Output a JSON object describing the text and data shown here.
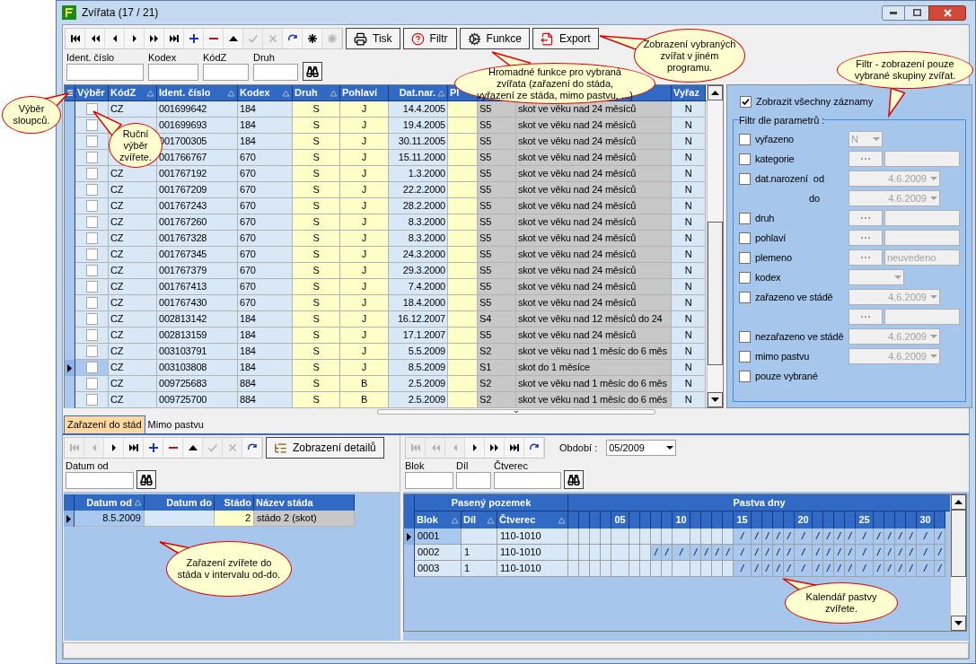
{
  "window": {
    "title": "Zvířata (17 / 21)"
  },
  "toolbar": {
    "navigator": [
      {
        "kind": "first",
        "disabled": false
      },
      {
        "kind": "rewind",
        "disabled": false
      },
      {
        "kind": "prev",
        "disabled": false
      },
      {
        "kind": "next",
        "disabled": false
      },
      {
        "kind": "ffwd",
        "disabled": false
      },
      {
        "kind": "last",
        "disabled": false
      },
      {
        "kind": "plus",
        "disabled": false
      },
      {
        "kind": "minus",
        "disabled": false
      },
      {
        "kind": "up",
        "disabled": false
      },
      {
        "kind": "check",
        "disabled": true
      },
      {
        "kind": "x",
        "disabled": true
      },
      {
        "kind": "refresh",
        "disabled": false
      },
      {
        "kind": "star",
        "disabled": false
      },
      {
        "kind": "star",
        "disabled": true
      }
    ],
    "buttons": [
      {
        "kind": "print",
        "label": "Tisk"
      },
      {
        "kind": "filter",
        "label": "Filtr"
      },
      {
        "kind": "functions",
        "label": "Funkce"
      },
      {
        "kind": "export",
        "label": "Export"
      }
    ]
  },
  "search": [
    {
      "label": "Ident. číslo"
    },
    {
      "label": "Kodex"
    },
    {
      "label": "KódZ"
    },
    {
      "label": "Druh"
    }
  ],
  "grid": {
    "columns": [
      {
        "label": "Výběr",
        "sortable": false
      },
      {
        "label": "KódZ",
        "sortable": true
      },
      {
        "label": "Ident. číslo",
        "sortable": true
      },
      {
        "label": "Kodex",
        "sortable": true
      },
      {
        "label": "Druh",
        "sortable": true
      },
      {
        "label": "Pohlaví",
        "sortable": false
      },
      {
        "label": "Dat.nar.",
        "sortable": true
      },
      {
        "label": "Pl",
        "sortable": false
      },
      {
        "label": "Vyřaz",
        "sortable": false
      }
    ],
    "rows": [
      {
        "selected": false,
        "checked": false,
        "kodz": "CZ",
        "ident": "001699642",
        "kodex": "184",
        "druh": "S",
        "pohlavi": "J",
        "datnar": "14.4.2005",
        "kat": "S5",
        "popis": "skot ve věku nad 24 měsíců",
        "vyraz": "N"
      },
      {
        "selected": false,
        "checked": false,
        "ident": "001699693",
        "kodex": "184",
        "druh": "S",
        "pohlavi": "J",
        "datnar": "19.4.2005",
        "kat": "S5",
        "popis": "skot ve věku nad 24 měsíců",
        "vyraz": "N"
      },
      {
        "selected": false,
        "checked": false,
        "ident": "001700305",
        "kodex": "184",
        "druh": "S",
        "pohlavi": "J",
        "datnar": "30.11.2005",
        "kat": "S5",
        "popis": "skot ve věku nad 24 měsíců",
        "vyraz": "N"
      },
      {
        "selected": false,
        "checked": false,
        "ident": "001766767",
        "kodex": "670",
        "druh": "S",
        "pohlavi": "J",
        "datnar": "15.11.2000",
        "kat": "S5",
        "popis": "skot ve věku nad 24 měsíců",
        "vyraz": "N"
      },
      {
        "selected": false,
        "checked": false,
        "kodz": "CZ",
        "ident": "001767192",
        "kodex": "670",
        "druh": "S",
        "pohlavi": "J",
        "datnar": "1.3.2000",
        "kat": "S5",
        "popis": "skot ve věku nad 24 měsíců",
        "vyraz": "N"
      },
      {
        "selected": false,
        "checked": false,
        "kodz": "CZ",
        "ident": "001767209",
        "kodex": "670",
        "druh": "S",
        "pohlavi": "J",
        "datnar": "22.2.2000",
        "kat": "S5",
        "popis": "skot ve věku nad 24 měsíců",
        "vyraz": "N"
      },
      {
        "selected": false,
        "checked": false,
        "kodz": "CZ",
        "ident": "001767243",
        "kodex": "670",
        "druh": "S",
        "pohlavi": "J",
        "datnar": "28.2.2000",
        "kat": "S5",
        "popis": "skot ve věku nad 24 měsíců",
        "vyraz": "N"
      },
      {
        "selected": false,
        "checked": false,
        "kodz": "CZ",
        "ident": "001767260",
        "kodex": "670",
        "druh": "S",
        "pohlavi": "J",
        "datnar": "8.3.2000",
        "kat": "S5",
        "popis": "skot ve věku nad 24 měsíců",
        "vyraz": "N"
      },
      {
        "selected": false,
        "checked": false,
        "kodz": "CZ",
        "ident": "001767328",
        "kodex": "670",
        "druh": "S",
        "pohlavi": "J",
        "datnar": "8.3.2000",
        "kat": "S5",
        "popis": "skot ve věku nad 24 měsíců",
        "vyraz": "N"
      },
      {
        "selected": false,
        "checked": false,
        "kodz": "CZ",
        "ident": "001767345",
        "kodex": "670",
        "druh": "S",
        "pohlavi": "J",
        "datnar": "24.3.2000",
        "kat": "S5",
        "popis": "skot ve věku nad 24 měsíců",
        "vyraz": "N"
      },
      {
        "selected": false,
        "checked": false,
        "kodz": "CZ",
        "ident": "001767379",
        "kodex": "670",
        "druh": "S",
        "pohlavi": "J",
        "datnar": "29.3.2000",
        "kat": "S5",
        "popis": "skot ve věku nad 24 měsíců",
        "vyraz": "N"
      },
      {
        "selected": false,
        "checked": false,
        "kodz": "CZ",
        "ident": "001767413",
        "kodex": "670",
        "druh": "S",
        "pohlavi": "J",
        "datnar": "7.4.2000",
        "kat": "S5",
        "popis": "skot ve věku nad 24 měsíců",
        "vyraz": "N"
      },
      {
        "selected": false,
        "checked": false,
        "kodz": "CZ",
        "ident": "001767430",
        "kodex": "670",
        "druh": "S",
        "pohlavi": "J",
        "datnar": "18.4.2000",
        "kat": "S5",
        "popis": "skot ve věku nad 24 měsíců",
        "vyraz": "N"
      },
      {
        "selected": false,
        "checked": false,
        "kodz": "CZ",
        "ident": "002813142",
        "kodex": "184",
        "druh": "S",
        "pohlavi": "J",
        "datnar": "16.12.2007",
        "kat": "S4",
        "popis": "skot ve věku nad 12 měsíců do 24",
        "vyraz": "N"
      },
      {
        "selected": false,
        "checked": false,
        "kodz": "CZ",
        "ident": "002813159",
        "kodex": "184",
        "druh": "S",
        "pohlavi": "J",
        "datnar": "17.1.2007",
        "kat": "S5",
        "popis": "skot ve věku nad 24 měsíců",
        "vyraz": "N"
      },
      {
        "selected": false,
        "checked": false,
        "kodz": "CZ",
        "ident": "003103791",
        "kodex": "184",
        "druh": "S",
        "pohlavi": "J",
        "datnar": "5.5.2009",
        "kat": "S2",
        "popis": "skot ve věku nad 1 měsíc do 6 měs",
        "vyraz": "N"
      },
      {
        "selected": true,
        "checked": false,
        "kodz": "CZ",
        "ident": "003103808",
        "kodex": "184",
        "druh": "S",
        "pohlavi": "J",
        "datnar": "8.5.2009",
        "kat": "S1",
        "popis": "skot do 1 měsíce",
        "vyraz": "N"
      },
      {
        "selected": false,
        "checked": false,
        "kodz": "CZ",
        "ident": "009725683",
        "kodex": "884",
        "druh": "S",
        "pohlavi": "B",
        "datnar": "2.5.2009",
        "kat": "S2",
        "popis": "skot ve věku nad 1 měsíc do 6 měs",
        "vyraz": "N"
      },
      {
        "selected": false,
        "checked": false,
        "kodz": "CZ",
        "ident": "009725700",
        "kodex": "884",
        "druh": "S",
        "pohlavi": "B",
        "datnar": "2.5.2009",
        "kat": "S2",
        "popis": "skot ve věku nad 1 měsíc do 6 měs",
        "vyraz": "N"
      }
    ]
  },
  "filter_panel": {
    "show_all": {
      "label": "Zobrazit všechny záznamy",
      "checked": true
    },
    "legend": "Filtr dle parametrů :",
    "filters": [
      {
        "kind": "combo",
        "label": "vyřazeno",
        "checked": false,
        "value": "N"
      },
      {
        "kind": "lookup",
        "label": "kategorie",
        "checked": false
      },
      {
        "kind": "date",
        "label": "dat.narození",
        "sub_label": "od",
        "checked": false,
        "value": "4.6.2009"
      },
      {
        "kind": "date_more",
        "sub_label": "do",
        "value": "4.6.2009"
      },
      {
        "kind": "lookup",
        "label": "druh",
        "checked": false
      },
      {
        "kind": "lookup",
        "label": "pohlaví",
        "checked": false
      },
      {
        "kind": "lookup",
        "label": "plemeno",
        "checked": false,
        "value": "neuvedeno"
      },
      {
        "kind": "combo_wide",
        "label": "kodex",
        "checked": false
      },
      {
        "kind": "date",
        "label": "zařazeno ve stádě",
        "checked": false,
        "value": "4.6.2009"
      },
      {
        "kind": "lookup_more"
      },
      {
        "kind": "date",
        "label": "nezařazeno ve stádě",
        "checked": false,
        "value": "4.6.2009"
      },
      {
        "kind": "date",
        "label": "mimo pastvu",
        "checked": false,
        "value": "4.6.2009"
      },
      {
        "kind": "check",
        "label": "pouze vybrané",
        "checked": false
      }
    ]
  },
  "tabs": [
    {
      "label": "Zařazení do stád",
      "selected": true
    },
    {
      "label": "Mimo pastvu",
      "selected": false
    }
  ],
  "herd_panel": {
    "navigator": [
      {
        "kind": "first",
        "disabled": true
      },
      {
        "kind": "prev",
        "disabled": true
      },
      {
        "kind": "next",
        "disabled": false
      },
      {
        "kind": "last",
        "disabled": false
      },
      {
        "kind": "plus",
        "disabled": false
      },
      {
        "kind": "minus",
        "disabled": false
      },
      {
        "kind": "up",
        "disabled": false
      },
      {
        "kind": "check",
        "disabled": true
      },
      {
        "kind": "x",
        "disabled": true
      },
      {
        "kind": "refresh",
        "disabled": false
      }
    ],
    "details_button": "Zobrazení detailů",
    "search": [
      {
        "label": "Datum od"
      }
    ],
    "columns": [
      {
        "label": "Datum od",
        "sortable": true
      },
      {
        "label": "Datum do",
        "sortable": false
      },
      {
        "label": "Stádo",
        "sortable": false
      },
      {
        "label": "Název stáda",
        "sortable": false
      }
    ],
    "rows": [
      {
        "selected": true,
        "datum_od": "8.5.2009",
        "stado": "2",
        "nazev": "stádo 2 (skot)"
      }
    ]
  },
  "pasture_panel": {
    "navigator": [
      {
        "kind": "first",
        "disabled": true
      },
      {
        "kind": "rewind",
        "disabled": true
      },
      {
        "kind": "prev",
        "disabled": true
      },
      {
        "kind": "next",
        "disabled": false
      },
      {
        "kind": "ffwd",
        "disabled": false
      },
      {
        "kind": "last",
        "disabled": false
      },
      {
        "kind": "refresh",
        "disabled": false
      }
    ],
    "period": {
      "label": "Období :",
      "value": "05/2009"
    },
    "search": [
      {
        "label": "Blok"
      },
      {
        "label": "Díl"
      },
      {
        "label": "Čtverec"
      }
    ],
    "group_headers": [
      "Pasený pozemek",
      "Pastva dny"
    ],
    "columns": [
      {
        "label": "Blok",
        "sortable": true
      },
      {
        "label": "Díl",
        "sortable": true
      },
      {
        "label": "Čtverec",
        "sortable": true
      }
    ],
    "days": [
      {
        "wide": false
      },
      {
        "wide": false
      },
      {
        "wide": false
      },
      {
        "wide": false
      },
      {
        "wide": true,
        "label": "05"
      },
      {
        "wide": false
      },
      {
        "wide": false
      },
      {
        "wide": false
      },
      {
        "wide": false
      },
      {
        "wide": true,
        "label": "10"
      },
      {
        "wide": false
      },
      {
        "wide": false
      },
      {
        "wide": false
      },
      {
        "wide": false
      },
      {
        "wide": true,
        "label": "15"
      },
      {
        "wide": false
      },
      {
        "wide": false
      },
      {
        "wide": false
      },
      {
        "wide": false
      },
      {
        "wide": true,
        "label": "20"
      },
      {
        "wide": false
      },
      {
        "wide": false
      },
      {
        "wide": false
      },
      {
        "wide": false
      },
      {
        "wide": true,
        "label": "25"
      },
      {
        "wide": false
      },
      {
        "wide": false
      },
      {
        "wide": false
      },
      {
        "wide": false
      },
      {
        "wide": true,
        "label": "30"
      },
      {
        "wide": false
      }
    ],
    "grazed_mark": "/",
    "rows": [
      {
        "selected": true,
        "blok": "0001",
        "ctverec": "110-1010",
        "grazed": [
          false,
          false,
          false,
          false,
          false,
          false,
          false,
          false,
          false,
          false,
          false,
          false,
          false,
          false,
          true,
          true,
          true,
          true,
          true,
          true,
          true,
          true,
          true,
          true,
          true,
          true,
          true,
          true,
          true,
          true,
          true
        ]
      },
      {
        "selected": false,
        "blok": "0002",
        "dil": "1",
        "ctverec": "110-1010",
        "grazed": [
          false,
          false,
          false,
          false,
          false,
          false,
          false,
          true,
          true,
          true,
          true,
          true,
          true,
          true,
          true,
          true,
          true,
          true,
          true,
          true,
          true,
          true,
          true,
          true,
          true,
          true,
          true,
          true,
          true,
          true,
          true
        ]
      },
      {
        "selected": false,
        "blok": "0003",
        "dil": "1",
        "ctverec": "110-1010",
        "grazed": [
          false,
          false,
          false,
          false,
          false,
          false,
          false,
          false,
          false,
          false,
          false,
          false,
          false,
          false,
          true,
          true,
          true,
          true,
          true,
          true,
          true,
          true,
          true,
          true,
          true,
          true,
          true,
          true,
          true,
          true,
          true
        ]
      }
    ]
  },
  "callouts": [
    "Výběr sloupců.",
    "Ruční výběr zvířete.",
    "Hromadné funkce pro vybraná zvířata (zařazení do stáda, vyřazení ze stáda, mimo pastvu, ...)",
    "Zobrazení vybraných zvířat v jiném programu.",
    "Filtr - zobrazení pouze vybrané skupiny zvířat.",
    "Zařazení zvířete do stáda v intervalu od-do.",
    "Kalendář pastvy zvířete."
  ]
}
